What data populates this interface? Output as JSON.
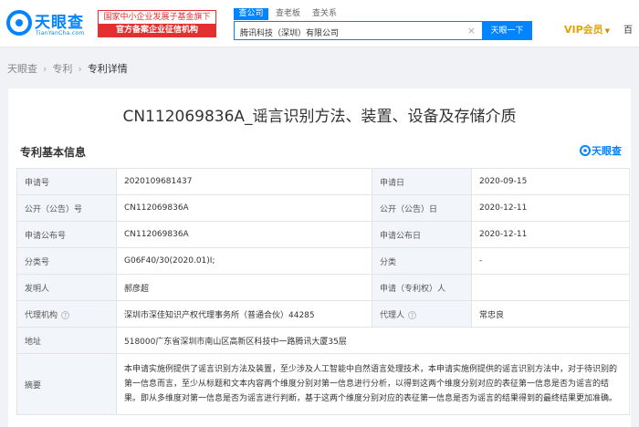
{
  "header": {
    "logo_text": "天眼查",
    "logo_domain": "TianYanCha.com",
    "slogan_line1": "国家中小企业发展子基金旗下",
    "slogan_line2": "官方备案企业征信机构",
    "search_tabs": [
      "查公司",
      "查老板",
      "查关系"
    ],
    "search_value": "腾讯科技（深圳）有限公司",
    "search_button": "天眼一下",
    "vip_label": "VIP会员",
    "right_cut_text": "百"
  },
  "breadcrumb": [
    "天眼查",
    "专利",
    "专利详情"
  ],
  "patent": {
    "title": "CN112069836A_谣言识别方法、装置、设备及存储介质",
    "section_title": "专利基本信息",
    "brand_label": "天眼查",
    "rows": [
      {
        "k1": "申请号",
        "v1": "2020109681437",
        "k2": "申请日",
        "v2": "2020-09-15"
      },
      {
        "k1": "公开（公告）号",
        "v1": "CN112069836A",
        "k2": "公开（公告）日",
        "v2": "2020-12-11"
      },
      {
        "k1": "申请公布号",
        "v1": "CN112069836A",
        "k2": "申请公布日",
        "v2": "2020-12-11"
      },
      {
        "k1": "分类号",
        "v1": "G06F40/30(2020.01)I;",
        "k2": "分类",
        "v2": "-"
      },
      {
        "k1": "发明人",
        "v1": "郝彦超",
        "k2": "申请（专利权）人",
        "v2": ""
      },
      {
        "k1": "代理机构",
        "v1": "深圳市深佳知识产权代理事务所（普通合伙）44285",
        "k2": "代理人",
        "v2": "常忠良"
      }
    ],
    "address_label": "地址",
    "address_value": "518000广东省深圳市南山区高新区科技中一路腾讯大厦35层",
    "abstract_label": "摘要",
    "abstract_value": "本申请实施例提供了谣言识别方法及装置，至少涉及人工智能中自然语言处理技术，本申请实施例提供的谣言识别方法中，对于待识别的第一信息而言，至少从标题和文本内容两个维度分别对第一信息进行分析，以得到这两个维度分别对应的表征第一信息是否为谣言的结果。即从多维度对第一信息是否为谣言进行判断，基于这两个维度分别对应的表征第一信息是否为谣言的结果得到的最终结果更加准确。"
  },
  "colors": {
    "brand_blue": "#0084ff",
    "slogan_red": "#e32f2f",
    "vip_gold": "#e0a400",
    "label_bg": "#f2f6fb"
  }
}
